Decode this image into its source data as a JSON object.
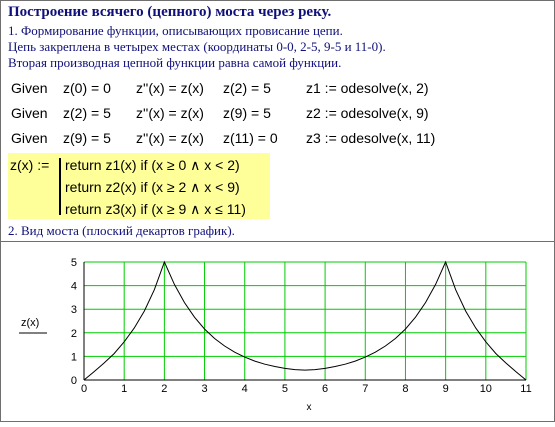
{
  "doc": {
    "title": "Построение всячего (цепного) моста через реку.",
    "lines": [
      "1. Формирование функции, описывающих провисание цепи.",
      "Цепь закреплена в четырех местах (координаты 0-0, 2-5, 9-5 и 11-0).",
      "Вторая производная цепной функции равна самой функции."
    ],
    "section2": "2. Вид моста (плоский декартов график)."
  },
  "given_rows": [
    {
      "given": "Given",
      "c1": "z(0) = 0",
      "c2": "z''(x) = z(x)",
      "c3": "z(2) = 5",
      "c4": "z1 := odesolve(x, 2)"
    },
    {
      "given": "Given",
      "c1": "z(2) = 5",
      "c2": "z''(x) = z(x)",
      "c3": "z(9) = 5",
      "c4": "z2 := odesolve(x, 9)"
    },
    {
      "given": "Given",
      "c1": "z(9) = 5",
      "c2": "z''(x) = z(x)",
      "c3": "z(11) = 0",
      "c4": "z3 := odesolve(x, 11)"
    }
  ],
  "piecewise": {
    "lhs": "z(x) :=",
    "rows": [
      "return  z1(x)   if   (x ≥ 0 ∧ x < 2)",
      "return  z2(x)   if   (x ≥ 2 ∧ x < 9)",
      "return  z3(x)   if   (x ≥ 9 ∧ x ≤ 11)"
    ]
  },
  "chart_data": {
    "type": "line",
    "xlabel": "x",
    "ylabel": "z(x)",
    "xlim": [
      0,
      11
    ],
    "ylim": [
      0,
      5
    ],
    "xticks": [
      0,
      1,
      2,
      3,
      4,
      5,
      6,
      7,
      8,
      9,
      10,
      11
    ],
    "yticks": [
      0,
      1,
      2,
      3,
      4,
      5
    ],
    "grid": true,
    "grid_color": "#00cc00",
    "line_color": "#000000",
    "series": [
      {
        "x": [
          0,
          0.25,
          0.5,
          0.75,
          1,
          1.25,
          1.5,
          1.75,
          2,
          2.25,
          2.5,
          2.75,
          3,
          3.25,
          3.5,
          3.75,
          4,
          4.25,
          4.5,
          4.75,
          5,
          5.25,
          5.5,
          5.75,
          6,
          6.25,
          6.5,
          6.75,
          7,
          7.25,
          7.5,
          7.75,
          8,
          8.25,
          8.5,
          8.75,
          9,
          9.25,
          9.5,
          9.75,
          10,
          10.25,
          10.5,
          10.75,
          11
        ],
        "y": [
          0,
          0.35,
          0.72,
          1.12,
          1.62,
          2.2,
          2.92,
          3.82,
          5,
          4.05,
          3.28,
          2.66,
          2.16,
          1.76,
          1.44,
          1.18,
          0.97,
          0.8,
          0.67,
          0.57,
          0.49,
          0.44,
          0.42,
          0.44,
          0.49,
          0.57,
          0.67,
          0.8,
          0.97,
          1.18,
          1.44,
          1.76,
          2.16,
          2.66,
          3.28,
          4.05,
          5,
          3.82,
          2.92,
          2.2,
          1.62,
          1.12,
          0.72,
          0.35,
          0
        ]
      }
    ]
  }
}
